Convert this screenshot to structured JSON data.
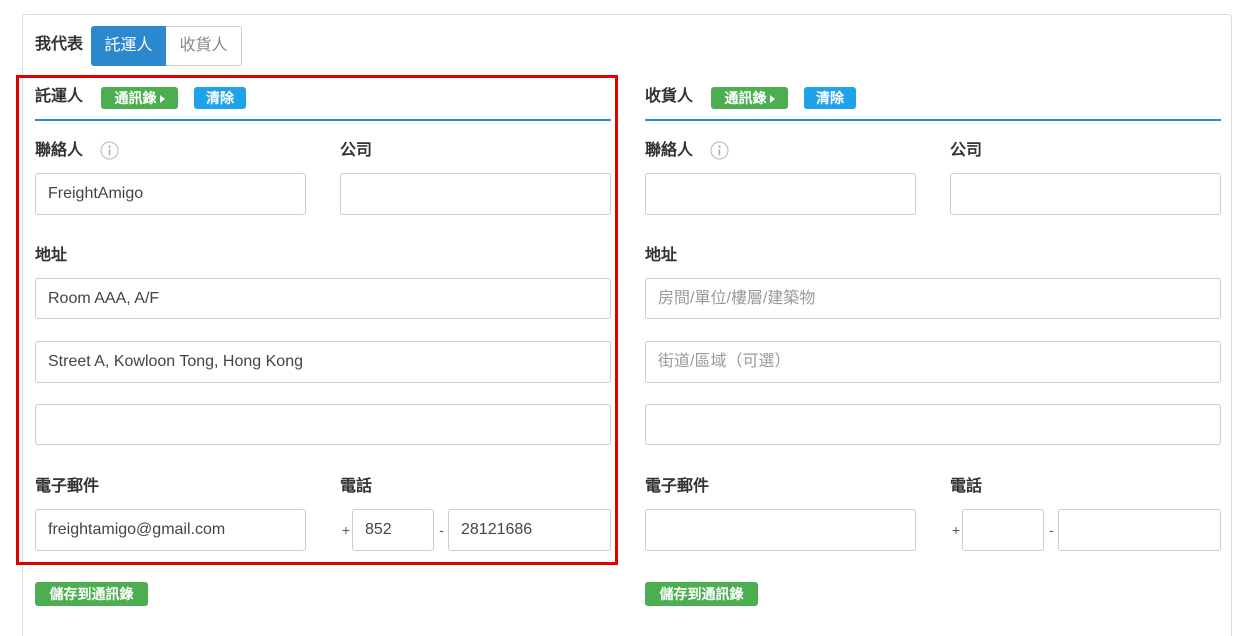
{
  "representing": {
    "label": "我代表",
    "options": [
      {
        "label": "託運人",
        "active": true
      },
      {
        "label": "收貨人",
        "active": false
      }
    ]
  },
  "shipper": {
    "title": "託運人",
    "address_book_label": "通訊錄",
    "clear_label": "清除",
    "contact": {
      "label": "聯絡人",
      "value": "FreightAmigo"
    },
    "company": {
      "label": "公司",
      "value": ""
    },
    "address": {
      "label": "地址",
      "lines": [
        {
          "value": "Room AAA, A/F"
        },
        {
          "value": "Street A, Kowloon Tong, Hong Kong"
        },
        {
          "value": ""
        }
      ]
    },
    "email": {
      "label": "電子郵件",
      "value": "freightamigo@gmail.com"
    },
    "phone": {
      "label": "電話",
      "prefix": "+",
      "country_code": "852",
      "separator": "-",
      "number": "28121686"
    },
    "save_label": "儲存到通訊錄"
  },
  "consignee": {
    "title": "收貨人",
    "address_book_label": "通訊錄",
    "clear_label": "清除",
    "contact": {
      "label": "聯絡人",
      "value": ""
    },
    "company": {
      "label": "公司",
      "value": ""
    },
    "address": {
      "label": "地址",
      "lines": [
        {
          "value": "",
          "placeholder": "房間/單位/樓層/建築物"
        },
        {
          "value": "",
          "placeholder": "街道/區域（可選）"
        },
        {
          "value": ""
        }
      ]
    },
    "email": {
      "label": "電子郵件",
      "value": ""
    },
    "phone": {
      "label": "電話",
      "prefix": "+",
      "country_code": "",
      "separator": "-",
      "number": ""
    },
    "save_label": "儲存到通訊錄"
  },
  "icons": {
    "contact_info": "info-icon",
    "address_book": "caret-right-icon"
  },
  "colors": {
    "primary": "#2b88cd",
    "success": "#4cae50",
    "info": "#1ea2e8",
    "highlight": "#e00000"
  }
}
